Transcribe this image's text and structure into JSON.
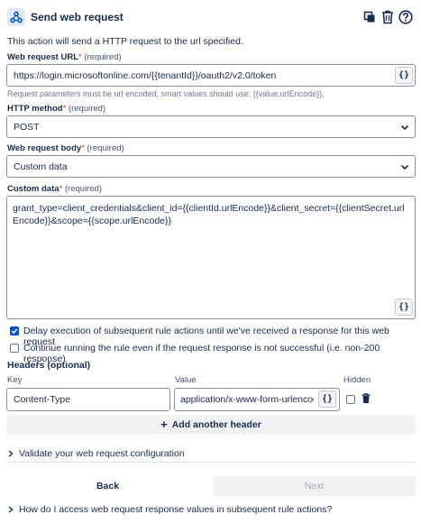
{
  "header": {
    "title": "Send web request",
    "copy_icon": "copy-icon",
    "delete_icon": "trash-icon",
    "help_icon": "help-icon"
  },
  "description": "This action will send a HTTP request to the url specified.",
  "url_field": {
    "label": "Web request URL",
    "required": "(required)",
    "value": "https://login.microsoftonline.com/{{tenantId}}/oauth2/v2.0/token",
    "smart_value_button": "{}",
    "hint": "Request parameters must be url encoded, smart values should use: {{value.urlEncode}}."
  },
  "method_field": {
    "label": "HTTP method",
    "required": "(required)",
    "value": "POST"
  },
  "body_field": {
    "label": "Web request body",
    "required": "(required)",
    "value": "Custom data"
  },
  "custom_data_field": {
    "label": "Custom data",
    "required": "(required)",
    "value": "grant_type=client_credentials&client_id={{clientId.urlEncode}}&client_secret={{clientSecret.urlEncode}}&scope={{scope.urlEncode}}",
    "smart_value_button": "{}"
  },
  "options": {
    "delay_label": "Delay execution of subsequent rule actions until we've received a response for this web request",
    "delay_checked": true,
    "continue_label": "Continue running the rule even if the request response is not successful (i.e. non-200 response)",
    "continue_checked": false
  },
  "headers": {
    "title": "Headers (optional)",
    "col_key": "Key",
    "col_value": "Value",
    "col_hidden": "Hidden",
    "rows": [
      {
        "key": "Content-Type",
        "value": "application/x-www-form-urlencoded",
        "smart_value_button": "{}",
        "hidden": false
      }
    ],
    "add_label": "Add another header"
  },
  "validate_label": "Validate your web request configuration",
  "footer": {
    "back_label": "Back",
    "next_label": "Next"
  },
  "faq_label": "How do I access web request response values in subsequent rule actions?",
  "colors": {
    "accent": "#0052cc",
    "text": "#172b4d",
    "required": "#de350b"
  }
}
